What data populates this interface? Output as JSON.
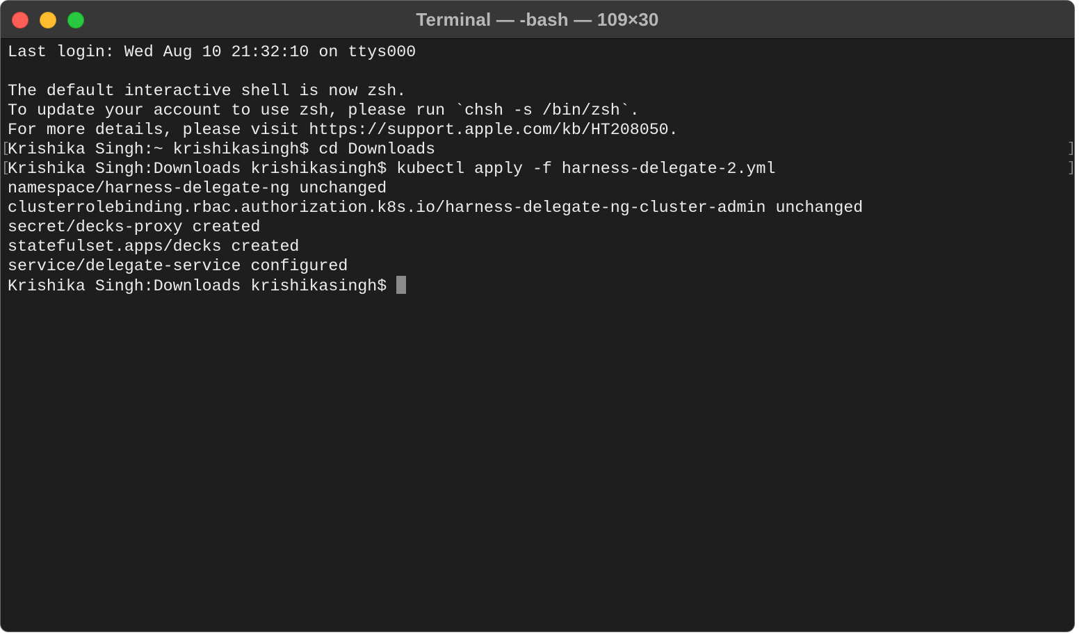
{
  "window": {
    "title": "Terminal — -bash — 109×30"
  },
  "terminal": {
    "lines": [
      "Last login: Wed Aug 10 21:32:10 on ttys000",
      "",
      "The default interactive shell is now zsh.",
      "To update your account to use zsh, please run `chsh -s /bin/zsh`.",
      "For more details, please visit https://support.apple.com/kb/HT208050.",
      "Krishika Singh:~ krishikasingh$ cd Downloads",
      "Krishika Singh:Downloads krishikasingh$ kubectl apply -f harness-delegate-2.yml",
      "namespace/harness-delegate-ng unchanged",
      "clusterrolebinding.rbac.authorization.k8s.io/harness-delegate-ng-cluster-admin unchanged",
      "secret/decks-proxy created",
      "statefulset.apps/decks created",
      "service/delegate-service configured"
    ],
    "prompt": "Krishika Singh:Downloads krishikasingh$ ",
    "marks": {
      "left": "[",
      "right": "]"
    }
  },
  "colors": {
    "background": "#1e1e1e",
    "titlebar": "#373737",
    "text": "#ececec",
    "cursor": "#8a8a8a",
    "close": "#ff5f57",
    "minimize": "#febc2e",
    "zoom": "#28c840"
  }
}
